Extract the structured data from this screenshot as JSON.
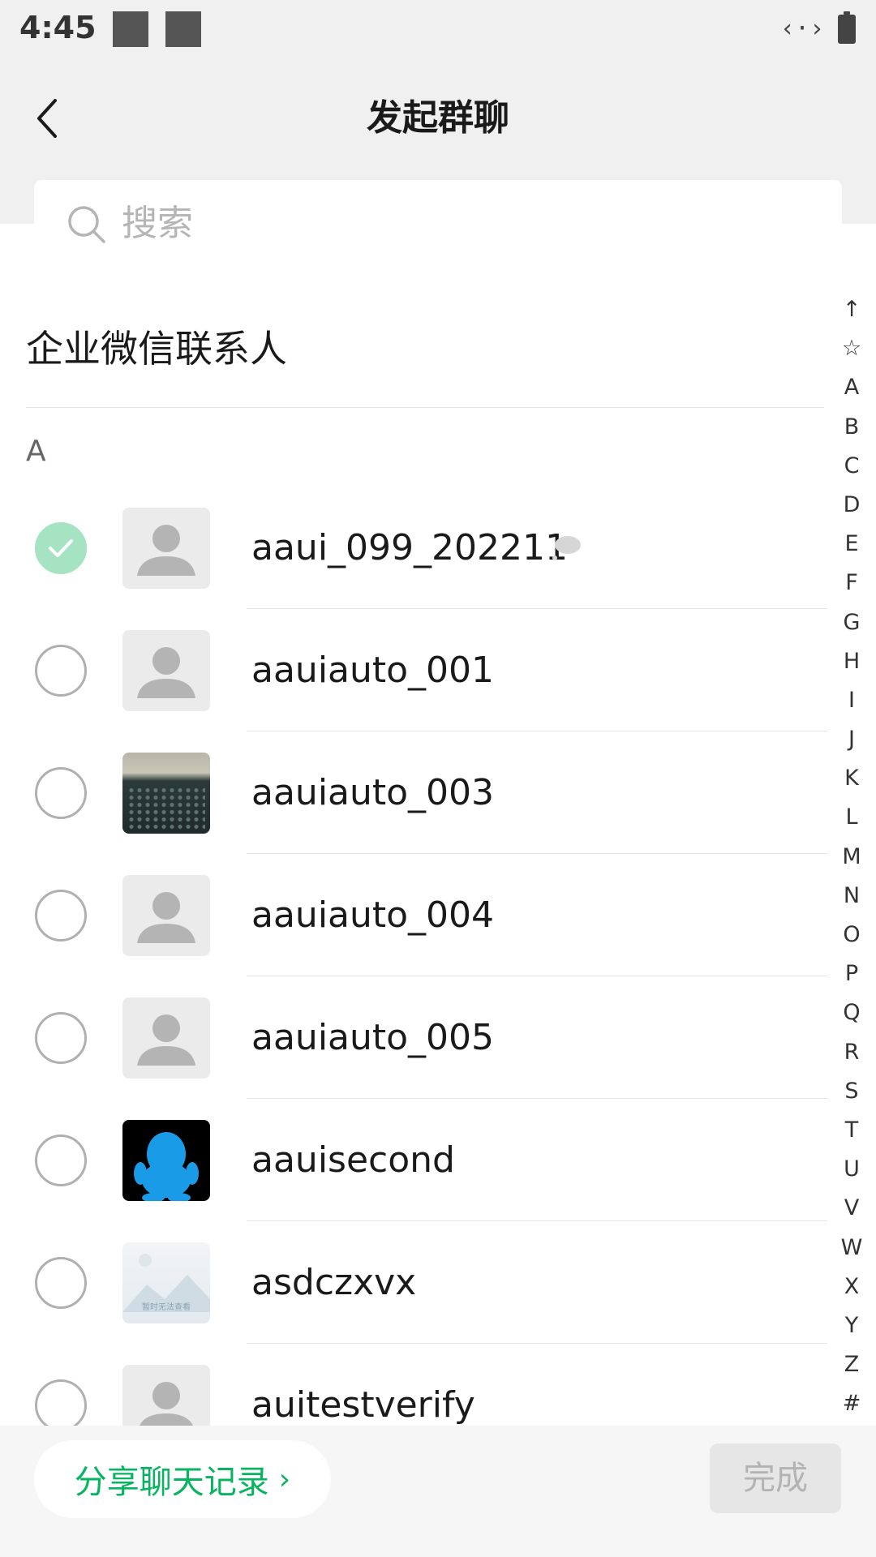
{
  "status_bar": {
    "time": "4:45",
    "network_glyph": "‹·›"
  },
  "header": {
    "title": "发起群聊",
    "search_placeholder": "搜索"
  },
  "section": {
    "title": "企业微信联系人",
    "letter": "A"
  },
  "contacts": [
    {
      "name": "aaui_099_202211",
      "checked": true,
      "avatar": "default"
    },
    {
      "name": "aauiauto_001",
      "checked": false,
      "avatar": "default"
    },
    {
      "name": "aauiauto_003",
      "checked": false,
      "avatar": "keyboard-photo"
    },
    {
      "name": "aauiauto_004",
      "checked": false,
      "avatar": "default"
    },
    {
      "name": "aauiauto_005",
      "checked": false,
      "avatar": "default"
    },
    {
      "name": "aauisecond",
      "checked": false,
      "avatar": "penguin"
    },
    {
      "name": "asdczxvx",
      "checked": false,
      "avatar": "image-placeholder",
      "avatar_caption": "暂时无法查看"
    },
    {
      "name": "auitestverify",
      "checked": false,
      "avatar": "default"
    }
  ],
  "alphabet_index": [
    "↑",
    "☆",
    "A",
    "B",
    "C",
    "D",
    "E",
    "F",
    "G",
    "H",
    "I",
    "J",
    "K",
    "L",
    "M",
    "N",
    "O",
    "P",
    "Q",
    "R",
    "S",
    "T",
    "U",
    "V",
    "W",
    "X",
    "Y",
    "Z",
    "#"
  ],
  "bottom_bar": {
    "share_label": "分享聊天记录",
    "share_chevron": "›",
    "done_label": "完成"
  },
  "colors": {
    "accent_green": "#07b561",
    "checked_green": "#a6e3c3",
    "header_bg": "#f0f0f0"
  }
}
